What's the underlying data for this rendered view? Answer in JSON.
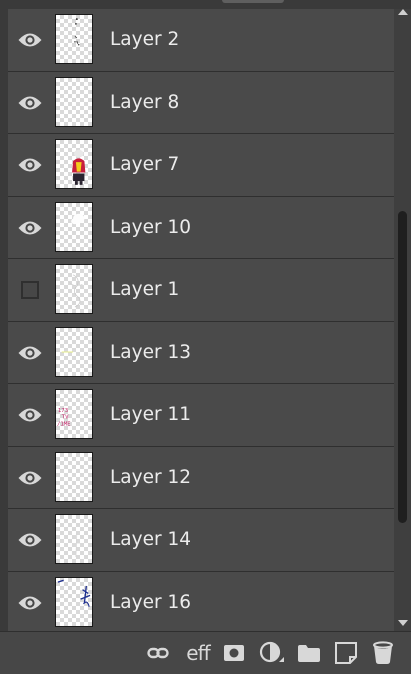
{
  "layers": [
    {
      "name": "Layer 2",
      "visible": true,
      "thumb": "sparse-dark-dots"
    },
    {
      "name": "Layer 8",
      "visible": true,
      "thumb": "empty"
    },
    {
      "name": "Layer 7",
      "visible": true,
      "thumb": "red-yellow-figure"
    },
    {
      "name": "Layer 10",
      "visible": true,
      "thumb": "white-blob"
    },
    {
      "name": "Layer 1",
      "visible": false,
      "thumb": "faint-sketch"
    },
    {
      "name": "Layer 13",
      "visible": true,
      "thumb": "yellow-mark"
    },
    {
      "name": "Layer 11",
      "visible": true,
      "thumb": "pink-text"
    },
    {
      "name": "Layer 12",
      "visible": true,
      "thumb": "empty"
    },
    {
      "name": "Layer 14",
      "visible": true,
      "thumb": "faint-line"
    },
    {
      "name": "Layer 16",
      "visible": true,
      "thumb": "blue-strokes"
    }
  ],
  "toolbar": {
    "effects_label": "eff",
    "buttons": [
      "link-icon",
      "effects-icon",
      "mask-icon",
      "adjustment-icon",
      "folder-icon",
      "new-layer-icon",
      "delete-icon"
    ]
  },
  "colors": {
    "panel_bg": "#4a4a4a",
    "row_separator": "#2f2f2f",
    "text": "#ececec",
    "icon": "#d8d8d8"
  }
}
